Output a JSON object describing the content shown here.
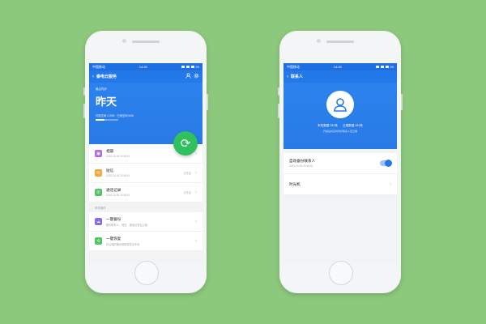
{
  "left_phone": {
    "status": {
      "carrier": "中国移动",
      "time": "14:45",
      "battery": "99"
    },
    "nav": {
      "back": "‹",
      "title": "秦电云服务"
    },
    "hero": {
      "last_sync_label": "最近同步",
      "last_sync_value": "昨天",
      "storage_text": "可用空间 3.2GB · 已用空间 50M",
      "storage_fraction": 0.4
    },
    "items": [
      {
        "label": "相册",
        "sub": "2015-10-26 20:45:01",
        "status": "已开启",
        "color": "#b36bdc"
      },
      {
        "label": "短信",
        "sub": "2015-10-26 20:45:01",
        "status": "已开启",
        "color": "#f3a83b"
      },
      {
        "label": "通话记录",
        "sub": "2015-10-26 20:45:01",
        "status": "已开启",
        "color": "#52c563"
      }
    ],
    "section_title": "本机操作",
    "actions": [
      {
        "label": "一键备份",
        "sub": "备份联系人、短信、通话记录至云端",
        "color": "#8a6ee6",
        "glyph": "☁"
      },
      {
        "label": "一键恢复",
        "sub": "将云端的备份数据恢复至本机",
        "color": "#52c563",
        "glyph": "⟲"
      }
    ]
  },
  "right_phone": {
    "status": {
      "carrier": "中国移动",
      "time": "14:45",
      "battery": "99"
    },
    "nav": {
      "back": "‹",
      "title": "联系人"
    },
    "profile": {
      "local_count": "本机数据 251条",
      "cloud_count": "云端数据 251条",
      "hint": "开启后将实时同步联系人至云端"
    },
    "settings": [
      {
        "label": "自动备份联系人",
        "sub": "2015-10-26 20:45:01",
        "toggle_on": true
      },
      {
        "label": "时光机"
      }
    ]
  }
}
